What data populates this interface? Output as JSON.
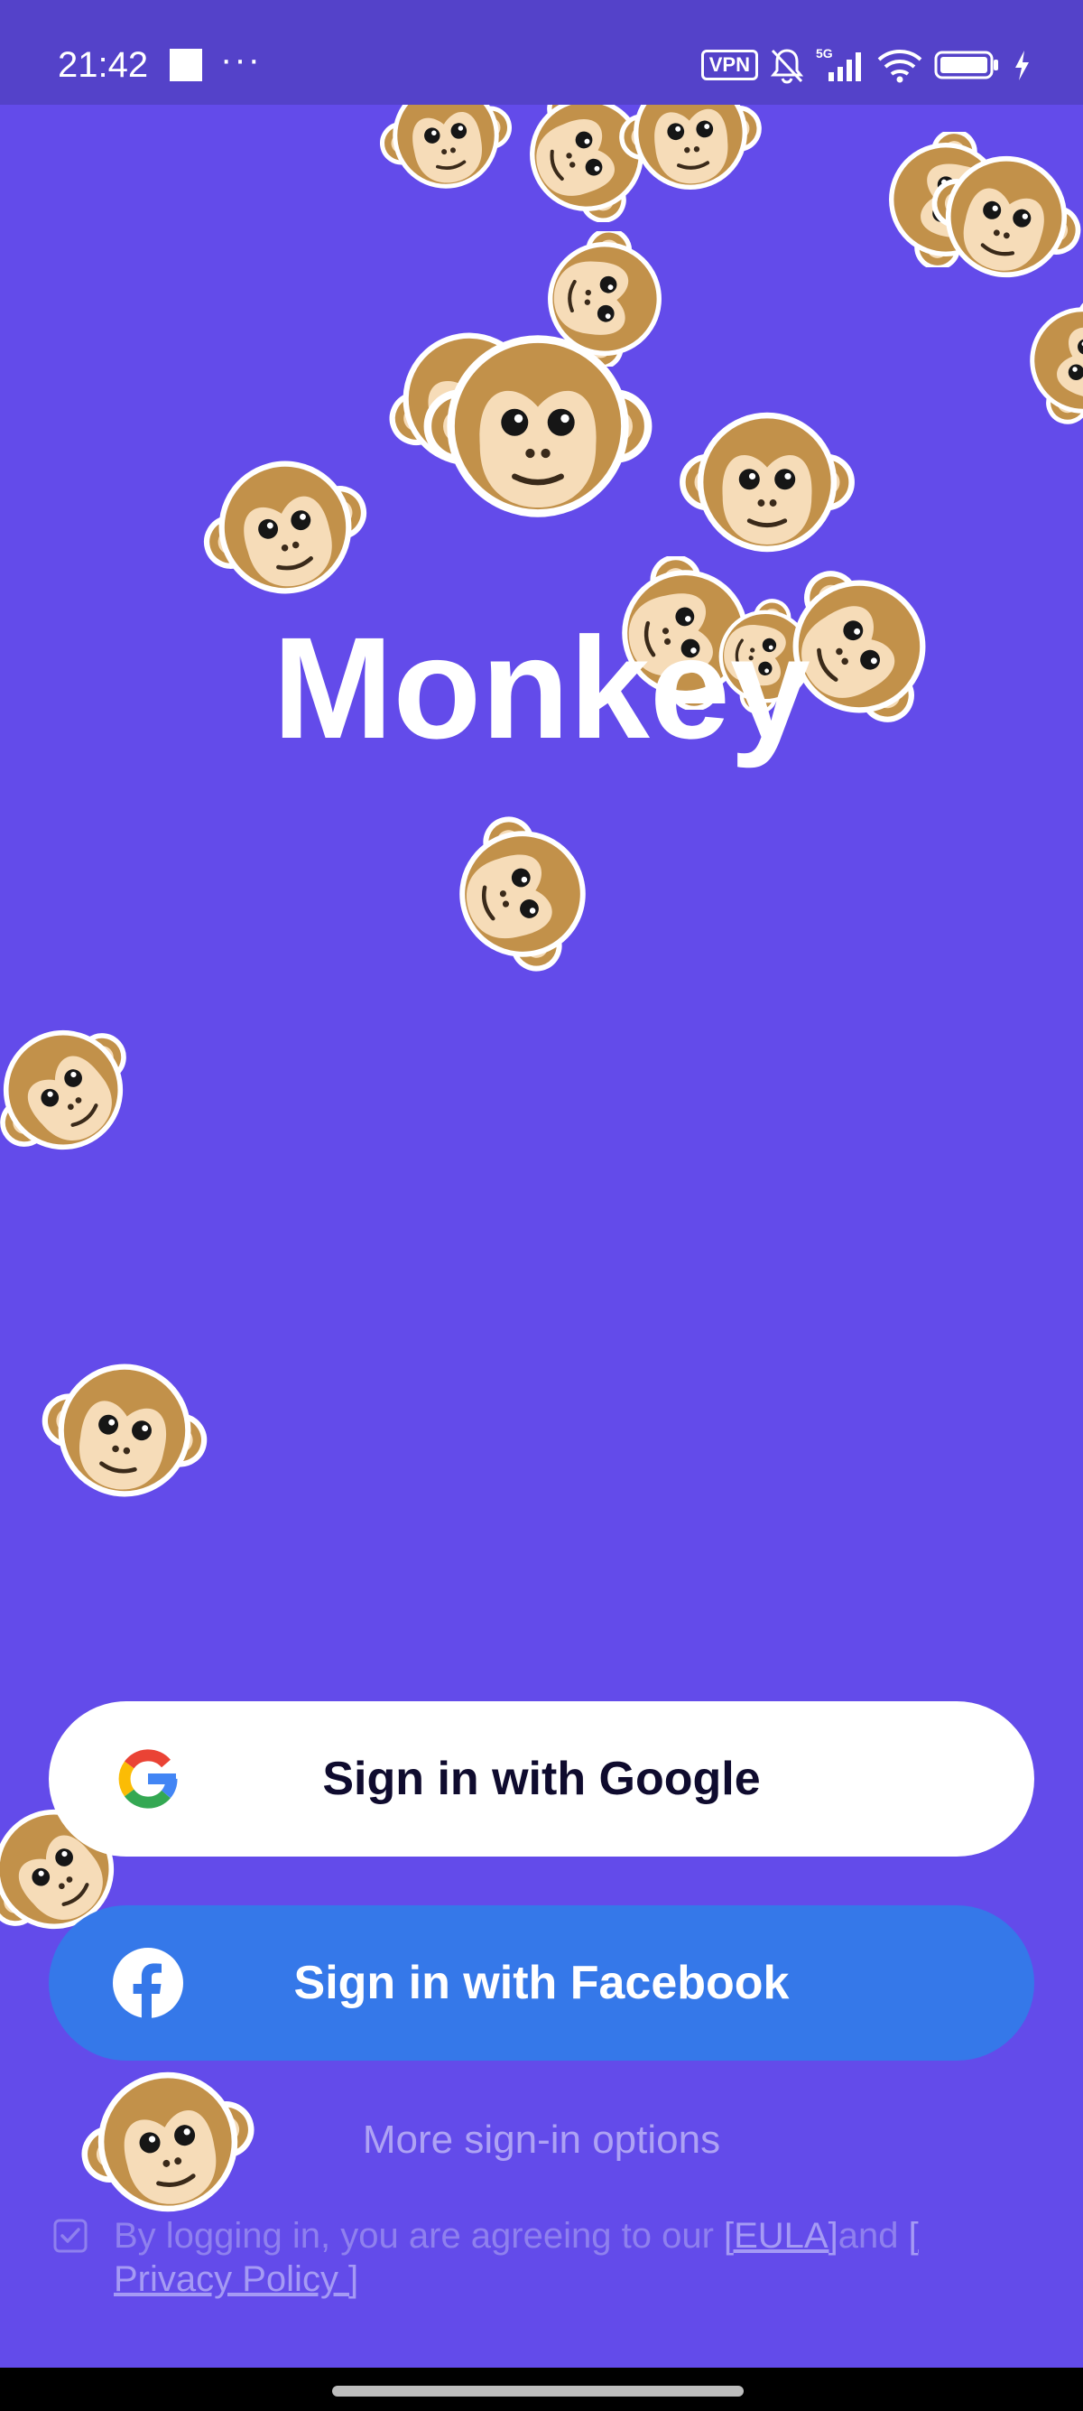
{
  "status_bar": {
    "time": "21:42",
    "overflow": "···",
    "vpn": "VPN",
    "network": "5G"
  },
  "app": {
    "title": "Monkey"
  },
  "buttons": {
    "google": "Sign in with Google",
    "facebook": "Sign in with Facebook"
  },
  "more_options": "More sign-in options",
  "consent": {
    "checked": true,
    "text": "By logging in, you are agreeing to our ",
    "eula": "[EULA]",
    "and": "and ",
    "privacy": "[ Privacy Policy ]"
  },
  "colors": {
    "background": "#634bea",
    "status_bar": "#5442c9",
    "facebook": "#3578e9",
    "monkey_fur": "#c2914a",
    "monkey_face": "#f6dcb8"
  },
  "icons": [
    "monkey-face",
    "google-g",
    "facebook-f",
    "checkbox-checked",
    "vpn",
    "bell-off",
    "signal",
    "wifi",
    "battery",
    "charging-bolt"
  ]
}
